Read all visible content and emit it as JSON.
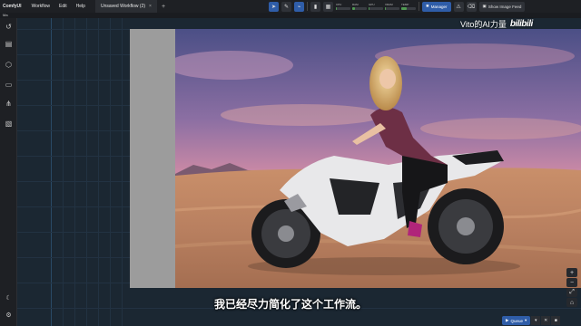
{
  "menubar": {
    "brand": "ComfyUI",
    "items": [
      "Workflow",
      "Edit",
      "Help"
    ],
    "tab_label": "Unsaved Workflow (2)",
    "tab_close": "×",
    "tab_add": "+"
  },
  "subbar": {
    "text": "Ma"
  },
  "toolbar": {
    "meters": [
      {
        "label": "CPU",
        "fraction": 0.06
      },
      {
        "label": "RAM",
        "fraction": 0.17
      },
      {
        "label": "GPU",
        "fraction": 0.02
      },
      {
        "label": "VRAM",
        "fraction": 0.08
      },
      {
        "label": "TEMP",
        "fraction": 0.35
      }
    ],
    "manager_label": "Manager",
    "feed_label": "Show Image Feed"
  },
  "watermark": {
    "text": "Vito的AI力量",
    "logo_text": "bilibili"
  },
  "subtitle": "我已经尽力简化了这个工作流。",
  "queue": {
    "label": "Queue"
  },
  "colors": {
    "accent": "#2f5da8",
    "canvas": "#1b2732",
    "bar": "#1e2024"
  }
}
